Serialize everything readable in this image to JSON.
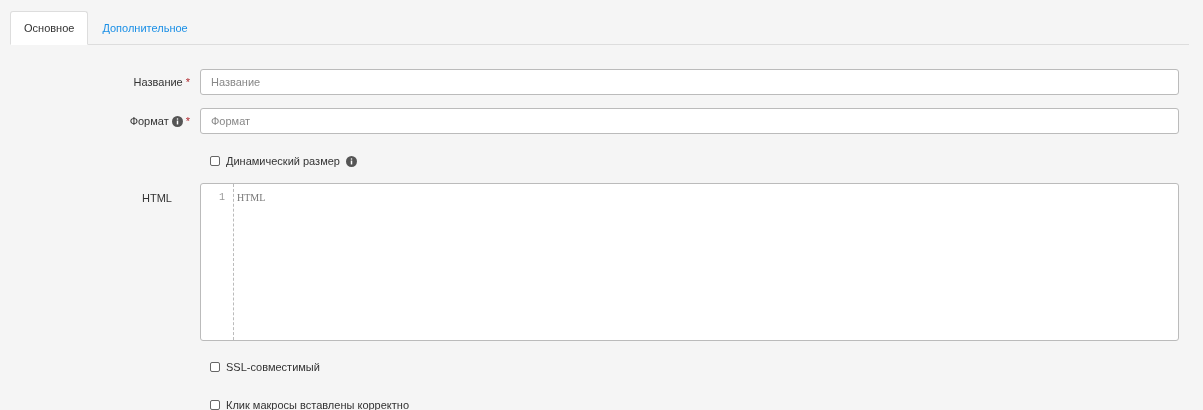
{
  "tabs": [
    {
      "label": "Основное",
      "selected": true
    },
    {
      "label": "Дополнительное",
      "selected": false
    }
  ],
  "fields": [
    {
      "kind": "text",
      "label": "Название",
      "required_mark": "*",
      "info": false,
      "placeholder": "Название"
    },
    {
      "kind": "text",
      "label": "Формат",
      "required_mark": "*",
      "info": true,
      "placeholder": "Формат"
    },
    {
      "kind": "checkbox",
      "label": "Динамический размер",
      "checked": false,
      "info": true
    },
    {
      "kind": "code",
      "label": "HTML",
      "line_number": "1",
      "placeholder": "HTML"
    },
    {
      "kind": "checkbox",
      "label": "SSL-совместимый",
      "checked": false,
      "info": false
    },
    {
      "kind": "checkbox",
      "label": "Клик макросы вставлены корректно",
      "checked": false,
      "info": false
    }
  ]
}
